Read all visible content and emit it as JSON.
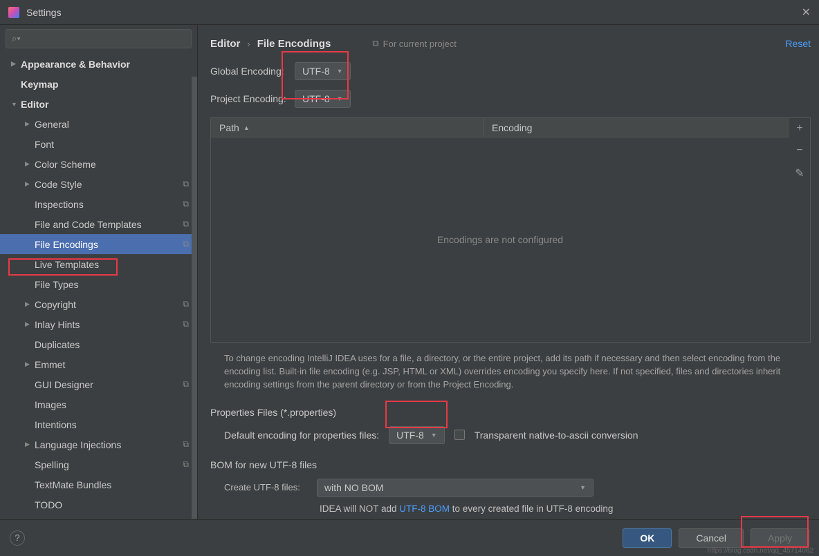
{
  "window": {
    "title": "Settings"
  },
  "sidebar": {
    "search_placeholder": "",
    "items": [
      {
        "label": "Appearance & Behavior",
        "arrow": "right",
        "bold": true,
        "lvl": 0
      },
      {
        "label": "Keymap",
        "arrow": "none",
        "bold": true,
        "lvl": 0
      },
      {
        "label": "Editor",
        "arrow": "down",
        "bold": true,
        "lvl": 0
      },
      {
        "label": "General",
        "arrow": "right",
        "lvl": 1
      },
      {
        "label": "Font",
        "arrow": "none",
        "lvl": 1
      },
      {
        "label": "Color Scheme",
        "arrow": "right",
        "lvl": 1
      },
      {
        "label": "Code Style",
        "arrow": "right",
        "lvl": 1,
        "mod": true
      },
      {
        "label": "Inspections",
        "arrow": "none",
        "lvl": 1,
        "mod": true
      },
      {
        "label": "File and Code Templates",
        "arrow": "none",
        "lvl": 1,
        "mod": true
      },
      {
        "label": "File Encodings",
        "arrow": "none",
        "lvl": 1,
        "mod": true,
        "selected": true
      },
      {
        "label": "Live Templates",
        "arrow": "none",
        "lvl": 1
      },
      {
        "label": "File Types",
        "arrow": "none",
        "lvl": 1
      },
      {
        "label": "Copyright",
        "arrow": "right",
        "lvl": 1,
        "mod": true
      },
      {
        "label": "Inlay Hints",
        "arrow": "right",
        "lvl": 1,
        "mod": true
      },
      {
        "label": "Duplicates",
        "arrow": "none",
        "lvl": 1
      },
      {
        "label": "Emmet",
        "arrow": "right",
        "lvl": 1
      },
      {
        "label": "GUI Designer",
        "arrow": "none",
        "lvl": 1,
        "mod": true
      },
      {
        "label": "Images",
        "arrow": "none",
        "lvl": 1
      },
      {
        "label": "Intentions",
        "arrow": "none",
        "lvl": 1
      },
      {
        "label": "Language Injections",
        "arrow": "right",
        "lvl": 1,
        "mod": true
      },
      {
        "label": "Spelling",
        "arrow": "none",
        "lvl": 1,
        "mod": true
      },
      {
        "label": "TextMate Bundles",
        "arrow": "none",
        "lvl": 1
      },
      {
        "label": "TODO",
        "arrow": "none",
        "lvl": 1
      }
    ]
  },
  "breadcrumb": {
    "a": "Editor",
    "b": "File Encodings",
    "note": "For current project",
    "reset": "Reset"
  },
  "global": {
    "label": "Global Encoding:",
    "value": "UTF-8"
  },
  "project": {
    "label": "Project Encoding:",
    "value": "UTF-8"
  },
  "table": {
    "col_path": "Path",
    "col_enc": "Encoding",
    "empty": "Encodings are not configured"
  },
  "help": "To change encoding IntelliJ IDEA uses for a file, a directory, or the entire project, add its path if necessary and then select encoding from the encoding list. Built-in file encoding (e.g. JSP, HTML or XML) overrides encoding you specify here. If not specified, files and directories inherit encoding settings from the parent directory or from the Project Encoding.",
  "props": {
    "title": "Properties Files (*.properties)",
    "label": "Default encoding for properties files:",
    "value": "UTF-8",
    "checkbox": "Transparent native-to-ascii conversion"
  },
  "bom": {
    "title": "BOM for new UTF-8 files",
    "label": "Create UTF-8 files:",
    "value": "with NO BOM",
    "note_pre": "IDEA will NOT add ",
    "note_link": "UTF-8 BOM",
    "note_post": " to every created file in UTF-8 encoding"
  },
  "footer": {
    "ok": "OK",
    "cancel": "Cancel",
    "apply": "Apply"
  },
  "watermark": "https://blog.csdn.net/qq_45714082"
}
